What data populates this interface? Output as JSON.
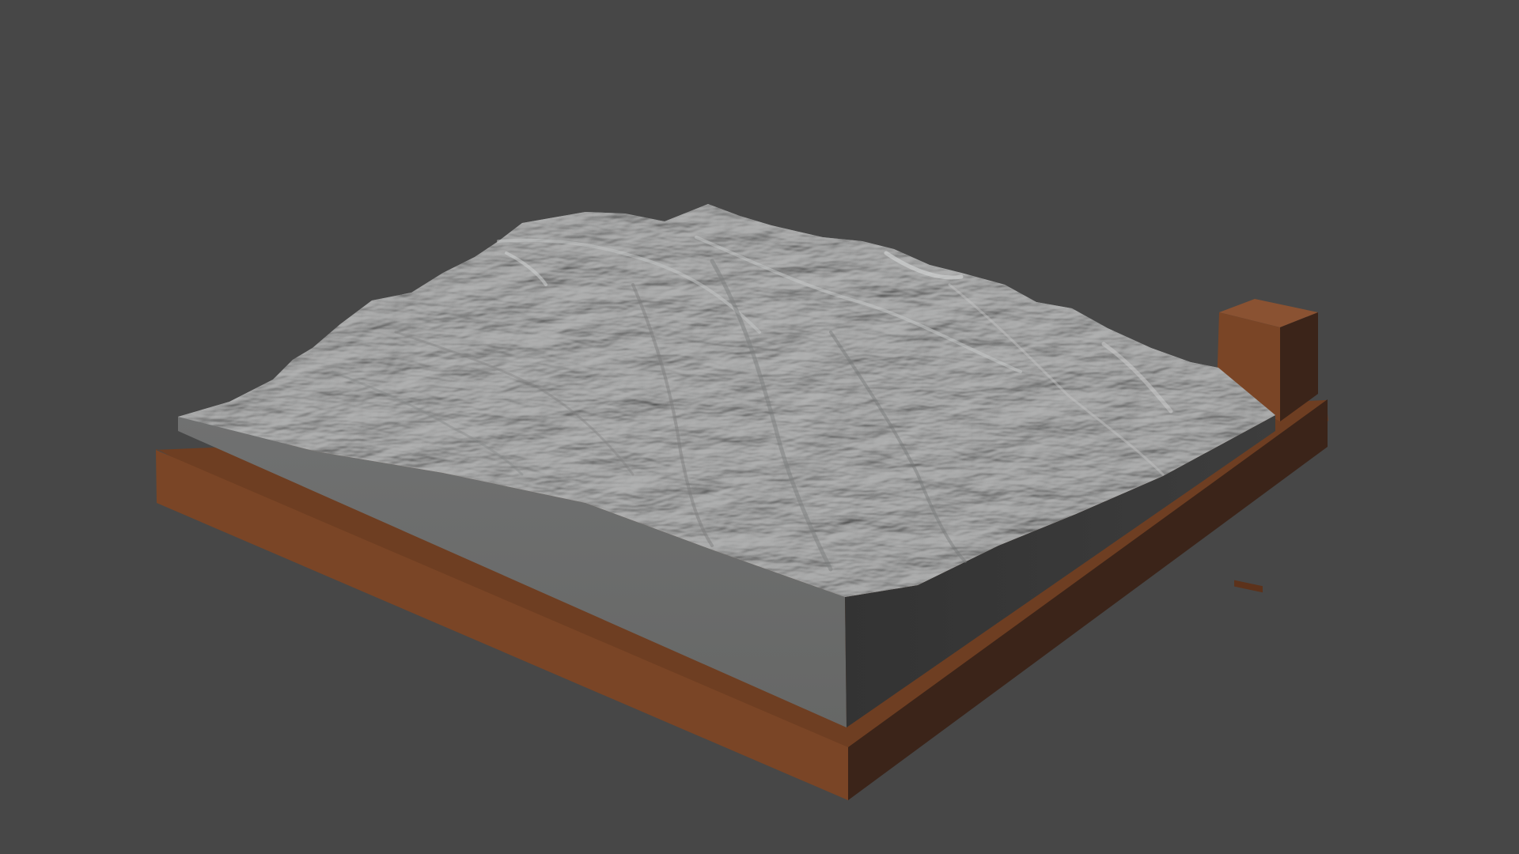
{
  "viewport": {
    "background": "#474747"
  },
  "model": {
    "terrain_top_color": "#9a9b9b",
    "terrain_ridge_light": "#c8c9c9",
    "terrain_shadow": "#6f7070",
    "terrain_front_face": "#6b6c6b",
    "terrain_side_face": "#3a3a3a",
    "base_front_color": "#7a4526",
    "base_top_color": "#6e3e22",
    "base_side_color": "#3b2419",
    "plaque_front_color": "#7a4526",
    "plaque_side_color": "#3b2419",
    "plaque_top_color": "#8a5232"
  }
}
